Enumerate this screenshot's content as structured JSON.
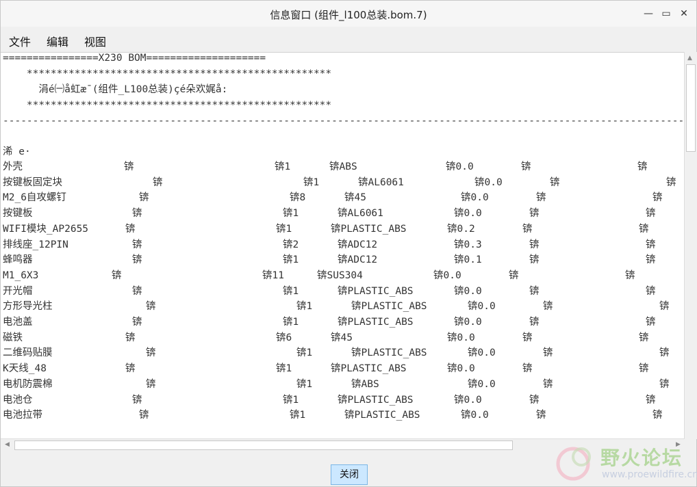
{
  "window": {
    "title": "信息窗口 (组件_l100总装.bom.7)",
    "minimize_glyph": "—",
    "maximize_glyph": "▭",
    "close_glyph": "✕"
  },
  "menu": [
    "文件",
    "编辑",
    "视图"
  ],
  "header_lines": [
    "================X230 BOM====================",
    "    ***************************************************",
    "      涓é㈠å虹æ¯(组件_L100总装)çé朵欢娓å:",
    "    ***************************************************",
    "------------------------------------------------------------------------------------------------------------------------------------------",
    "",
    "浠 e·"
  ],
  "rows": [
    {
      "name": "外壳",
      "c1": "锛",
      "qty": "锛1",
      "mat": "锛ABS",
      "wt": "锛0.0",
      "c5": "锛",
      "c6": "锛"
    },
    {
      "name": "按键板固定块",
      "c1": "锛",
      "qty": "锛1",
      "mat": "锛AL6061",
      "wt": "锛0.0",
      "c5": "锛",
      "c6": "锛"
    },
    {
      "name": "M2_6自攻螺钉",
      "c1": "锛",
      "qty": "锛8",
      "mat": "锛45",
      "wt": "锛0.0",
      "c5": "锛",
      "c6": "锛"
    },
    {
      "name": "按键板",
      "c1": "锛",
      "qty": "锛1",
      "mat": "锛AL6061",
      "wt": "锛0.0",
      "c5": "锛",
      "c6": "锛"
    },
    {
      "name": "WIFI模块_AP2655",
      "c1": "锛",
      "qty": "锛1",
      "mat": "锛PLASTIC_ABS",
      "wt": "锛0.2",
      "c5": "锛",
      "c6": "锛"
    },
    {
      "name": "排线座_12PIN",
      "c1": "锛",
      "qty": "锛2",
      "mat": "锛ADC12",
      "wt": "锛0.3",
      "c5": "锛",
      "c6": "锛"
    },
    {
      "name": "蜂鸣器",
      "c1": "锛",
      "qty": "锛1",
      "mat": "锛ADC12",
      "wt": "锛0.1",
      "c5": "锛",
      "c6": "锛"
    },
    {
      "name": "M1_6X3",
      "c1": "锛",
      "qty": "锛11",
      "mat": "锛SUS304",
      "wt": "锛0.0",
      "c5": "锛",
      "c6": "锛"
    },
    {
      "name": "开光帽",
      "c1": "锛",
      "qty": "锛1",
      "mat": "锛PLASTIC_ABS",
      "wt": "锛0.0",
      "c5": "锛",
      "c6": "锛"
    },
    {
      "name": "方形导光柱",
      "c1": "锛",
      "qty": "锛1",
      "mat": "锛PLASTIC_ABS",
      "wt": "锛0.0",
      "c5": "锛",
      "c6": "锛"
    },
    {
      "name": "电池盖",
      "c1": "锛",
      "qty": "锛1",
      "mat": "锛PLASTIC_ABS",
      "wt": "锛0.0",
      "c5": "锛",
      "c6": "锛"
    },
    {
      "name": "磁铁",
      "c1": "锛",
      "qty": "锛6",
      "mat": "锛45",
      "wt": "锛0.0",
      "c5": "锛",
      "c6": "锛"
    },
    {
      "name": "二维码贴膜",
      "c1": "锛",
      "qty": "锛1",
      "mat": "锛PLASTIC_ABS",
      "wt": "锛0.0",
      "c5": "锛",
      "c6": "锛"
    },
    {
      "name": "K天线_48",
      "c1": "锛",
      "qty": "锛1",
      "mat": "锛PLASTIC_ABS",
      "wt": "锛0.0",
      "c5": "锛",
      "c6": "锛"
    },
    {
      "name": "电机防震棉",
      "c1": "锛",
      "qty": "锛1",
      "mat": "锛ABS",
      "wt": "锛0.0",
      "c5": "锛",
      "c6": "锛"
    },
    {
      "name": "电池仓",
      "c1": "锛",
      "qty": "锛1",
      "mat": "锛PLASTIC_ABS",
      "wt": "锛0.0",
      "c5": "锛",
      "c6": "锛"
    },
    {
      "name": "电池拉带",
      "c1": "锛",
      "qty": "锛1",
      "mat": "锛PLASTIC_ABS",
      "wt": "锛0.0",
      "c5": "锛",
      "c6": "锛"
    }
  ],
  "footer": {
    "close_label": "关闭"
  },
  "watermark": {
    "text": "野火论坛",
    "url": "www.proewildfire.cn"
  }
}
